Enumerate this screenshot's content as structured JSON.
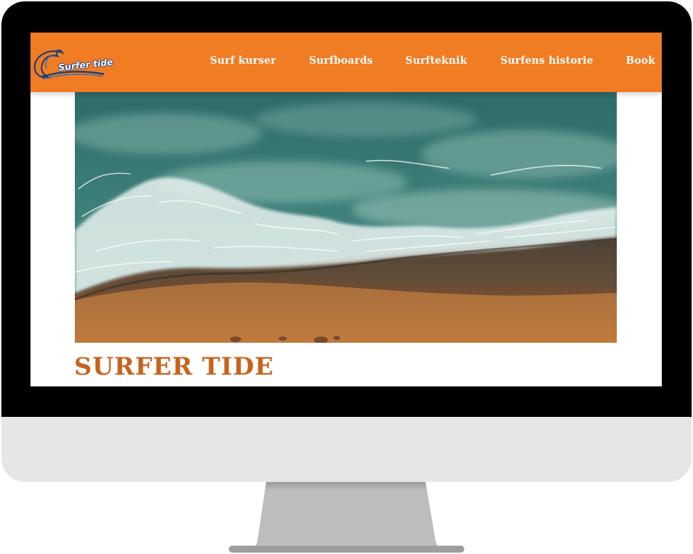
{
  "site": {
    "logo_text": "Surfer tide",
    "title": "SURFER TIDE"
  },
  "nav": {
    "items": [
      {
        "label": "Surf kurser"
      },
      {
        "label": "Surfboards"
      },
      {
        "label": "Surfteknik"
      },
      {
        "label": "Surfens historie"
      },
      {
        "label": "Book"
      }
    ]
  },
  "hero": {
    "image": "aerial-beach-waves"
  },
  "colors": {
    "accent": "#f07c23",
    "title": "#c8631d",
    "bezel": "#000000",
    "chin": "#e6e6e6",
    "stand": "#b3b3b3"
  }
}
